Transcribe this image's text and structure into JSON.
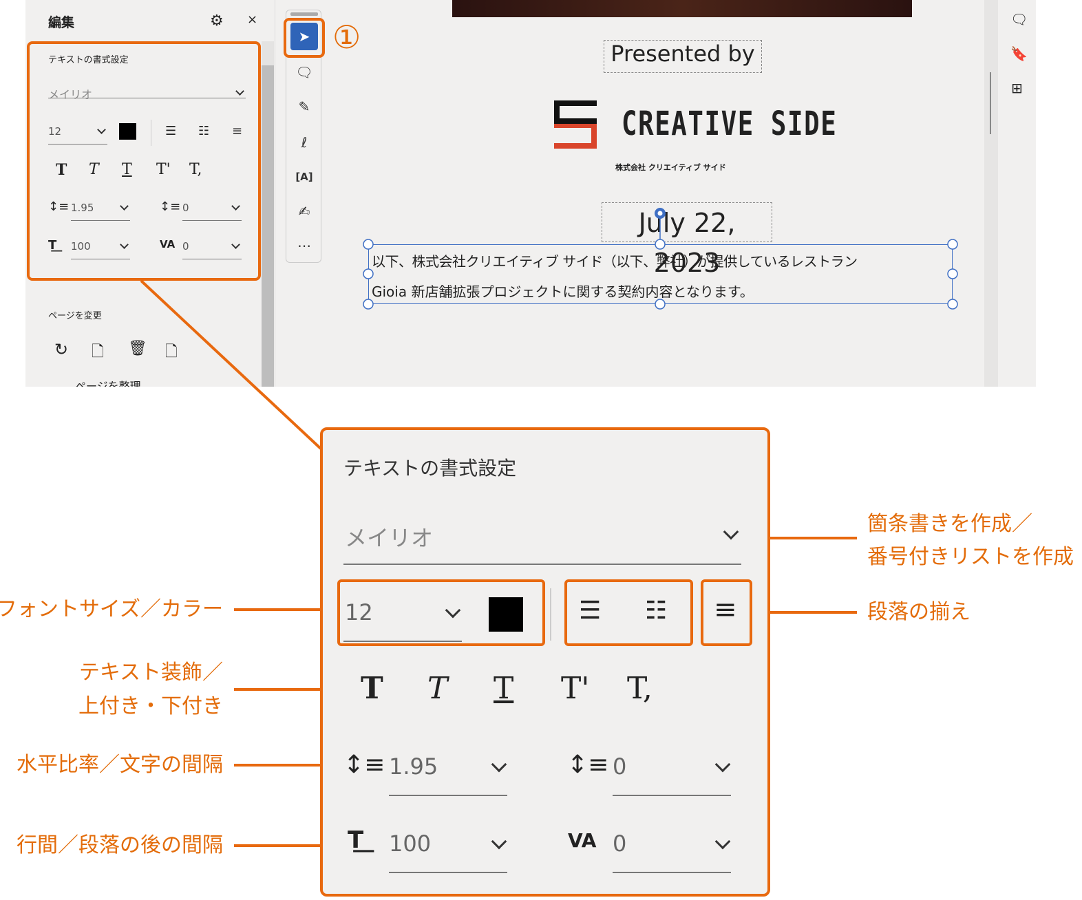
{
  "panel": {
    "title": "編集",
    "section_format": "テキストの書式設定",
    "font_name": "メイリオ",
    "font_size": "12",
    "color": "#000000",
    "line_spacing": "1.95",
    "para_spacing": "0",
    "h_scale": "100",
    "char_spacing": "0",
    "section_page": "ページを変更",
    "organize": "ページを整理"
  },
  "style_buttons": [
    "T",
    "T",
    "T",
    "T'",
    "T,"
  ],
  "step_marker": "①",
  "document": {
    "presented_by": "Presented by",
    "logo_text": "CREATIVE SIDE",
    "logo_sub": "株式会社 クリエイティブ サイド",
    "date": "July 22, 2023",
    "body_line1": "以下、株式会社クリエイティブ サイド（以下、弊社）が提供しているレストラン",
    "body_line2": "Gioia 新店舗拡張プロジェクトに関する契約内容となります。"
  },
  "callouts": {
    "font_size_color": "フォントサイズ／カラー",
    "decoration_1": "テキスト装飾／",
    "decoration_2": "上付き・下付き",
    "hscale_spacing": "水平比率／文字の間隔",
    "line_para": "行間／段落の後の間隔",
    "list_1": "箇条書きを作成／",
    "list_2": "番号付きリストを作成",
    "align": "段落の揃え"
  },
  "colors": {
    "accent": "#e8690f",
    "selection": "#3f6fc4",
    "tool_active": "#2f64b8"
  }
}
